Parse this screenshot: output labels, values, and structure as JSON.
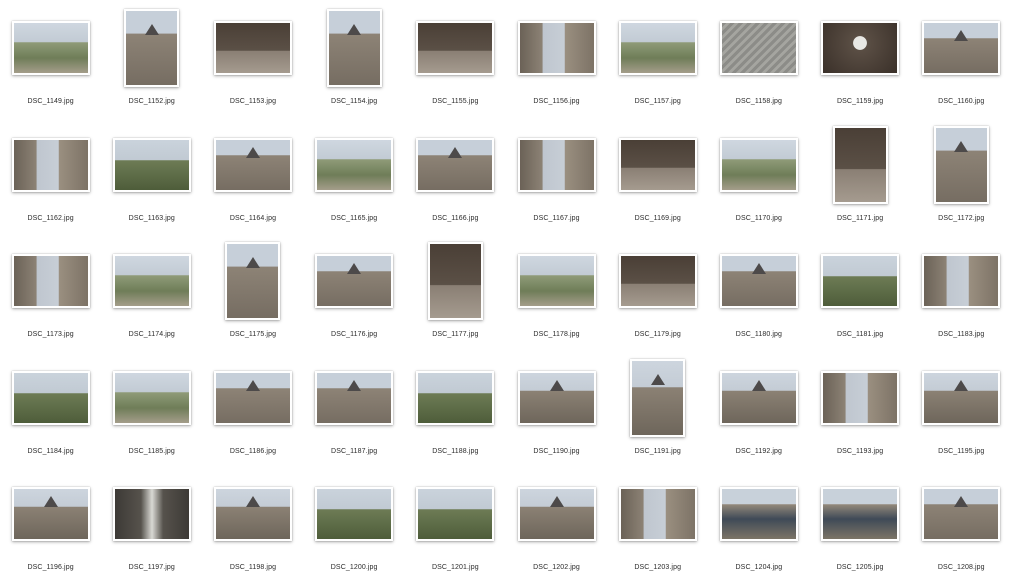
{
  "files": [
    {
      "name": "DSC_1149.jpg",
      "orientation": "landscape",
      "theme": "view"
    },
    {
      "name": "DSC_1152.jpg",
      "orientation": "portrait",
      "theme": "tower"
    },
    {
      "name": "DSC_1153.jpg",
      "orientation": "landscape",
      "theme": "room"
    },
    {
      "name": "DSC_1154.jpg",
      "orientation": "portrait",
      "theme": "tower"
    },
    {
      "name": "DSC_1155.jpg",
      "orientation": "landscape",
      "theme": "room"
    },
    {
      "name": "DSC_1156.jpg",
      "orientation": "landscape",
      "theme": "wall"
    },
    {
      "name": "DSC_1157.jpg",
      "orientation": "landscape",
      "theme": "view"
    },
    {
      "name": "DSC_1158.jpg",
      "orientation": "landscape",
      "theme": "roof"
    },
    {
      "name": "DSC_1159.jpg",
      "orientation": "landscape",
      "theme": "dark"
    },
    {
      "name": "DSC_1160.jpg",
      "orientation": "landscape",
      "theme": "tower"
    },
    {
      "name": "DSC_1162.jpg",
      "orientation": "landscape",
      "theme": "wall"
    },
    {
      "name": "DSC_1163.jpg",
      "orientation": "landscape",
      "theme": "green"
    },
    {
      "name": "DSC_1164.jpg",
      "orientation": "landscape",
      "theme": "tower"
    },
    {
      "name": "DSC_1165.jpg",
      "orientation": "landscape",
      "theme": "view"
    },
    {
      "name": "DSC_1166.jpg",
      "orientation": "landscape",
      "theme": "tower"
    },
    {
      "name": "DSC_1167.jpg",
      "orientation": "landscape",
      "theme": "wall"
    },
    {
      "name": "DSC_1169.jpg",
      "orientation": "landscape",
      "theme": "room"
    },
    {
      "name": "DSC_1170.jpg",
      "orientation": "landscape",
      "theme": "view"
    },
    {
      "name": "DSC_1171.jpg",
      "orientation": "portrait",
      "theme": "room"
    },
    {
      "name": "DSC_1172.jpg",
      "orientation": "portrait",
      "theme": "tower"
    },
    {
      "name": "DSC_1173.jpg",
      "orientation": "landscape",
      "theme": "wall"
    },
    {
      "name": "DSC_1174.jpg",
      "orientation": "landscape",
      "theme": "view"
    },
    {
      "name": "DSC_1175.jpg",
      "orientation": "portrait",
      "theme": "tower"
    },
    {
      "name": "DSC_1176.jpg",
      "orientation": "landscape",
      "theme": "tower"
    },
    {
      "name": "DSC_1177.jpg",
      "orientation": "portrait",
      "theme": "room"
    },
    {
      "name": "DSC_1178.jpg",
      "orientation": "landscape",
      "theme": "view"
    },
    {
      "name": "DSC_1179.jpg",
      "orientation": "landscape",
      "theme": "room"
    },
    {
      "name": "DSC_1180.jpg",
      "orientation": "landscape",
      "theme": "tower"
    },
    {
      "name": "DSC_1181.jpg",
      "orientation": "landscape",
      "theme": "green"
    },
    {
      "name": "DSC_1183.jpg",
      "orientation": "landscape",
      "theme": "wall"
    },
    {
      "name": "DSC_1184.jpg",
      "orientation": "landscape",
      "theme": "green"
    },
    {
      "name": "DSC_1185.jpg",
      "orientation": "landscape",
      "theme": "view"
    },
    {
      "name": "DSC_1186.jpg",
      "orientation": "landscape",
      "theme": "tower"
    },
    {
      "name": "DSC_1187.jpg",
      "orientation": "landscape",
      "theme": "tower"
    },
    {
      "name": "DSC_1188.jpg",
      "orientation": "landscape",
      "theme": "green"
    },
    {
      "name": "DSC_1190.jpg",
      "orientation": "landscape",
      "theme": "church"
    },
    {
      "name": "DSC_1191.jpg",
      "orientation": "portrait",
      "theme": "church"
    },
    {
      "name": "DSC_1192.jpg",
      "orientation": "landscape",
      "theme": "church"
    },
    {
      "name": "DSC_1193.jpg",
      "orientation": "landscape",
      "theme": "wall"
    },
    {
      "name": "DSC_1195.jpg",
      "orientation": "landscape",
      "theme": "church"
    },
    {
      "name": "DSC_1196.jpg",
      "orientation": "landscape",
      "theme": "church"
    },
    {
      "name": "DSC_1197.jpg",
      "orientation": "landscape",
      "theme": "stair"
    },
    {
      "name": "DSC_1198.jpg",
      "orientation": "landscape",
      "theme": "church"
    },
    {
      "name": "DSC_1200.jpg",
      "orientation": "landscape",
      "theme": "green"
    },
    {
      "name": "DSC_1201.jpg",
      "orientation": "landscape",
      "theme": "green"
    },
    {
      "name": "DSC_1202.jpg",
      "orientation": "landscape",
      "theme": "church"
    },
    {
      "name": "DSC_1203.jpg",
      "orientation": "landscape",
      "theme": "wall"
    },
    {
      "name": "DSC_1204.jpg",
      "orientation": "landscape",
      "theme": "arena"
    },
    {
      "name": "DSC_1205.jpg",
      "orientation": "landscape",
      "theme": "arena"
    },
    {
      "name": "DSC_1208.jpg",
      "orientation": "landscape",
      "theme": "tower"
    }
  ]
}
